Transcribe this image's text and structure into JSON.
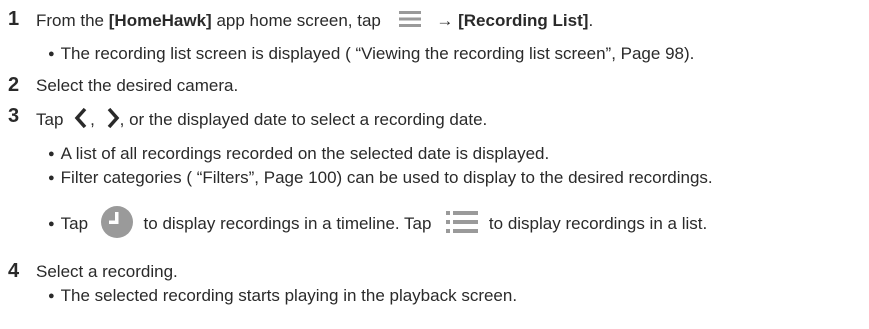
{
  "steps": [
    {
      "num": "1",
      "pre": "From the ",
      "app": "[HomeHawk]",
      "mid": " app home screen, tap",
      "arrow": "→",
      "menu": "[Recording List]",
      "end": "."
    },
    {
      "num": "2",
      "text": "Select the desired camera."
    },
    {
      "num": "3",
      "pre": "Tap",
      "sep1": ",",
      "post": ", or the displayed date to select a recording date."
    },
    {
      "num": "4",
      "text": "Select a recording."
    }
  ],
  "bullets": {
    "s1_b1": "The recording list screen is displayed ( “Viewing the recording list screen”, Page 98).",
    "s3_b1": "A list of all recordings recorded on the selected date is displayed.",
    "s3_b2": "Filter categories ( “Filters”, Page 100) can be used to display to the desired recordings.",
    "s3_b3_pre": "Tap",
    "s3_b3_mid": "to display recordings in a timeline. Tap",
    "s3_b3_end": "to display recordings in a list.",
    "s4_b1": "The selected recording starts playing in the playback screen."
  },
  "bullet_char": "●",
  "icons": [
    "menu-icon",
    "chevron-left-icon",
    "chevron-right-icon",
    "clock-icon",
    "list-icon"
  ],
  "colors": {
    "text": "#2a2a2a",
    "icon_gray": "#9a9a9a"
  }
}
